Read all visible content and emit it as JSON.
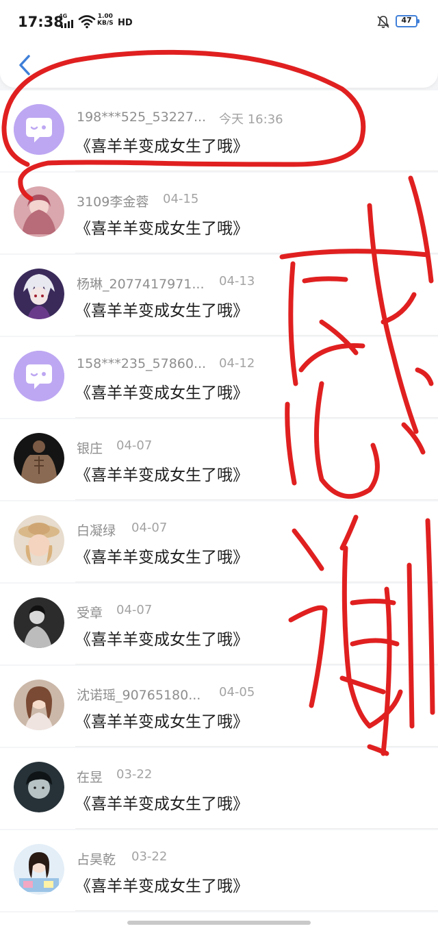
{
  "status_bar": {
    "time": "17:38",
    "network": "4G",
    "speed_value": "1.00",
    "speed_unit": "KB/S",
    "hd": "HD",
    "battery": "47"
  },
  "header": {
    "back_icon": "chevron-left-icon"
  },
  "colors": {
    "accent": "#3f7fd8",
    "default_avatar": "#bda7f2",
    "annotation_red": "#e02020"
  },
  "rows": [
    {
      "name": "198***525_53227...",
      "time": "今天 16:36",
      "message": "《喜羊羊变成女生了哦》",
      "avatar": "default-chat-avatar"
    },
    {
      "name": "3109李金蓉",
      "time": "04-15",
      "message": "《喜羊羊变成女生了哦》",
      "avatar": "photo"
    },
    {
      "name": "杨琳_2077417971...",
      "time": "04-13",
      "message": "《喜羊羊变成女生了哦》",
      "avatar": "photo"
    },
    {
      "name": "158***235_57860...",
      "time": "04-12",
      "message": "《喜羊羊变成女生了哦》",
      "avatar": "default-chat-avatar"
    },
    {
      "name": "银庄",
      "time": "04-07",
      "message": "《喜羊羊变成女生了哦》",
      "avatar": "photo"
    },
    {
      "name": "白凝绿",
      "time": "04-07",
      "message": "《喜羊羊变成女生了哦》",
      "avatar": "photo"
    },
    {
      "name": "受章",
      "time": "04-07",
      "message": "《喜羊羊变成女生了哦》",
      "avatar": "photo"
    },
    {
      "name": "沈诺瑶_90765180...",
      "time": "04-05",
      "message": "《喜羊羊变成女生了哦》",
      "avatar": "photo"
    },
    {
      "name": "在昱",
      "time": "03-22",
      "message": "《喜羊羊变成女生了哦》",
      "avatar": "photo"
    },
    {
      "name": "占昊乾",
      "time": "03-22",
      "message": "《喜羊羊变成女生了哦》",
      "avatar": "photo"
    }
  ],
  "annotation": {
    "text": "感谢"
  }
}
